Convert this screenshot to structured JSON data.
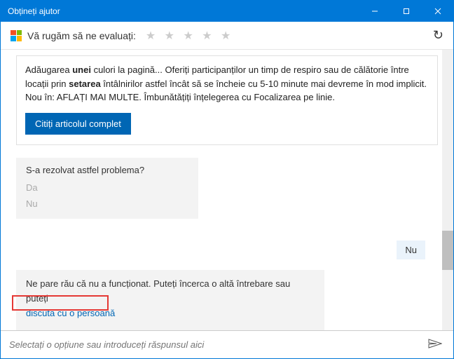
{
  "titlebar": {
    "title": "Obțineți ajutor"
  },
  "rating": {
    "prompt": "Vă rugăm să ne evaluați:",
    "stars": "★ ★ ★ ★ ★"
  },
  "article": {
    "line1a": "Adăugarea ",
    "line1b": "unei",
    "line1c": " culori la pagină... Oferiți participanților un timp de respiro sau de călătorie între locații prin ",
    "line1d": "setarea",
    "line1e": " întâlnirilor astfel încât să se încheie cu 5-10 minute mai devreme în mod implicit. Nou în: AFLAȚI MAI MULTE. Îmbunătățiți înțelegerea cu Focalizarea pe linie.",
    "button": "Citiți articolul complet"
  },
  "feedback": {
    "question": "S-a rezolvat astfel problema?",
    "yes": "Da",
    "no": "Nu"
  },
  "user_reply": "Nu",
  "followup": {
    "text": "Ne pare rău că nu a funcționat. Puteți încerca o altă întrebare sau puteți",
    "link": "discuta cu o persoană"
  },
  "input": {
    "placeholder": "Selectați o opțiune sau introduceți răspunsul aici"
  }
}
